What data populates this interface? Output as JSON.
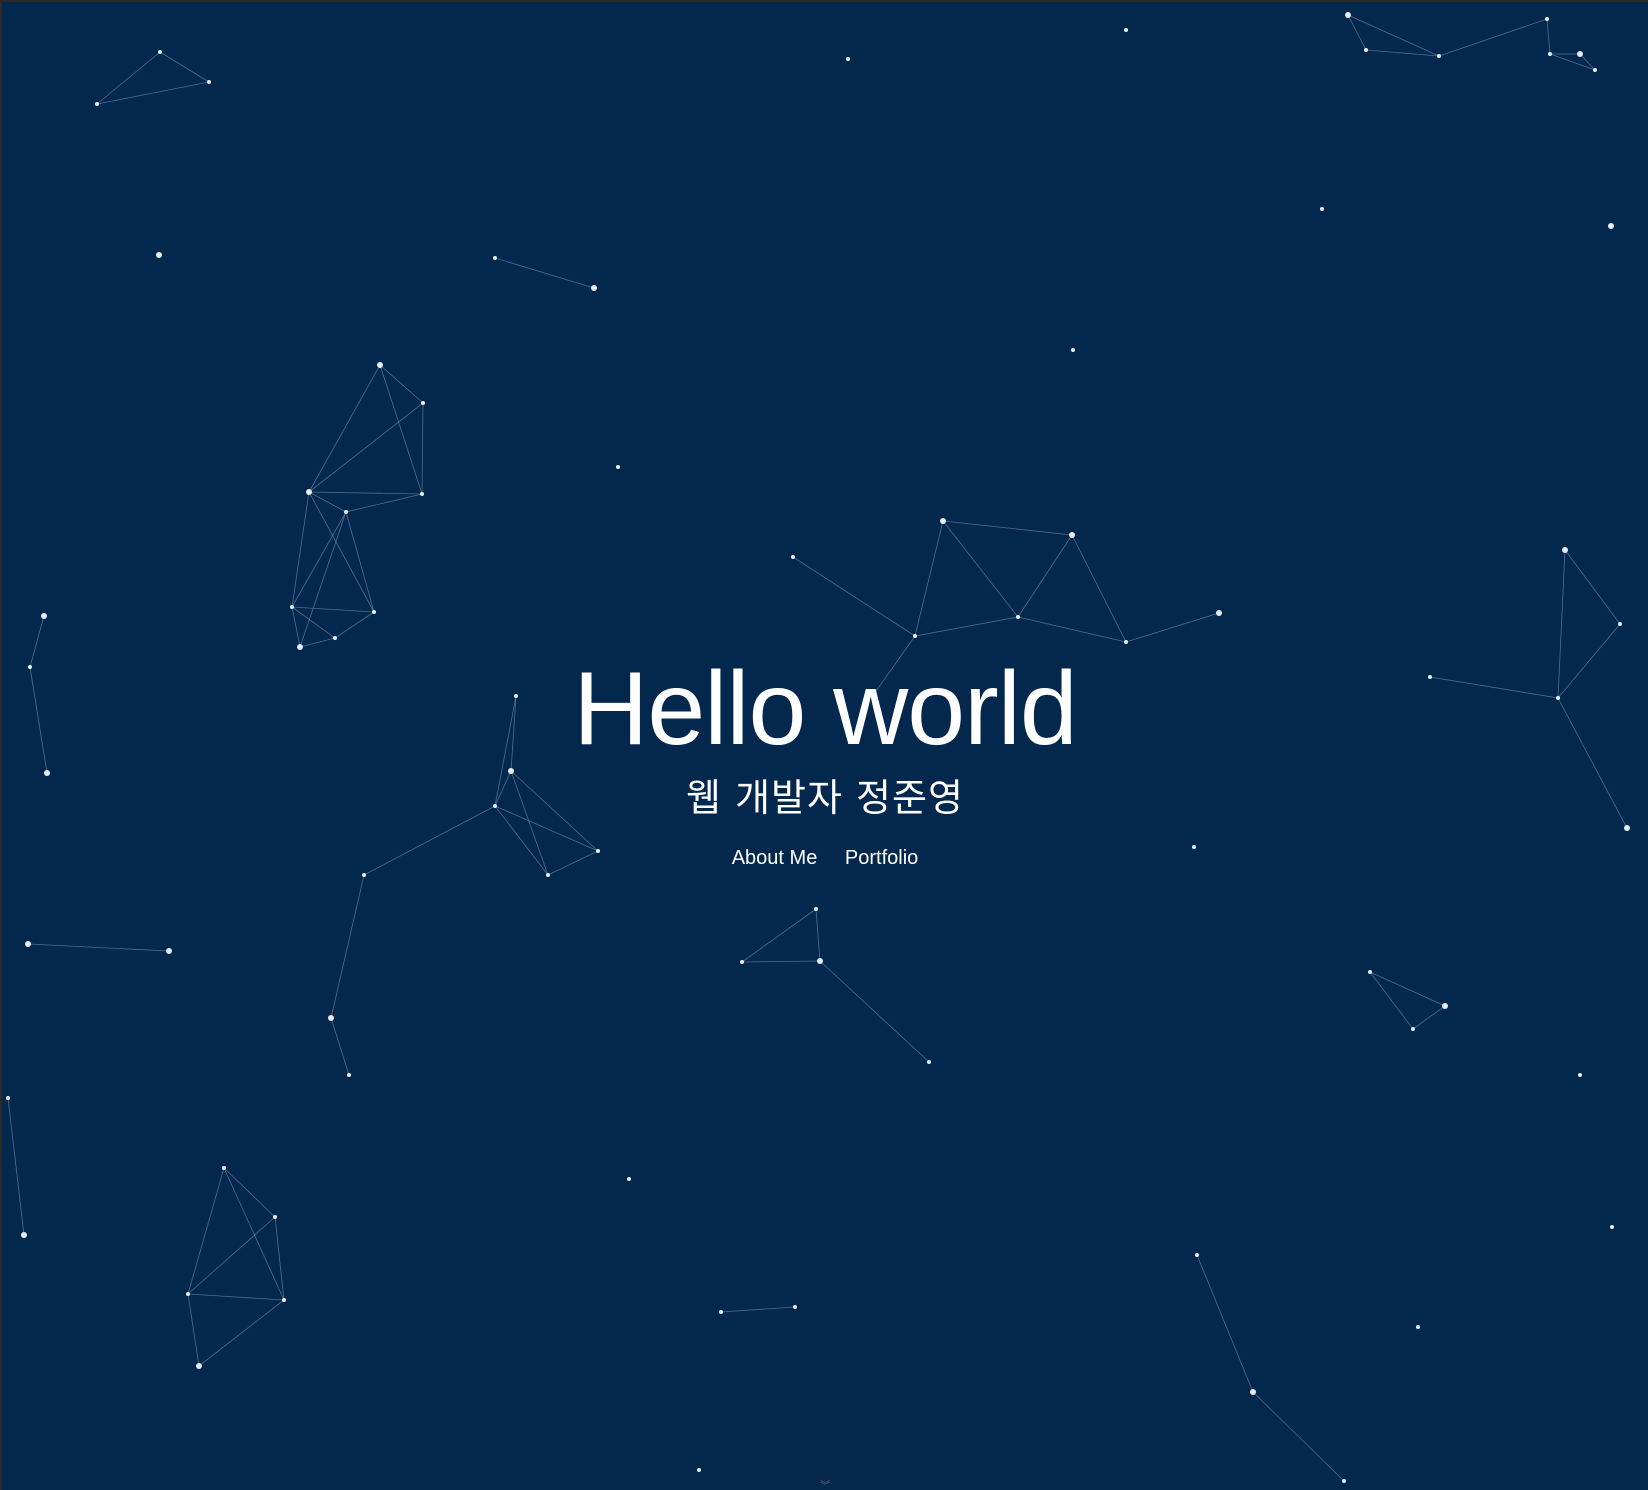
{
  "page": {
    "background_color": "#04284d",
    "particle_color": "#e6ecf2",
    "line_color": "#8ea3c0"
  },
  "hero": {
    "title": "Hello world",
    "subtitle": "웹 개발자 정준영"
  },
  "nav": {
    "items": [
      {
        "label": "About Me"
      },
      {
        "label": "Portfolio"
      }
    ]
  },
  "scroll_indicator": {
    "icon": "chevron-down-icon"
  }
}
